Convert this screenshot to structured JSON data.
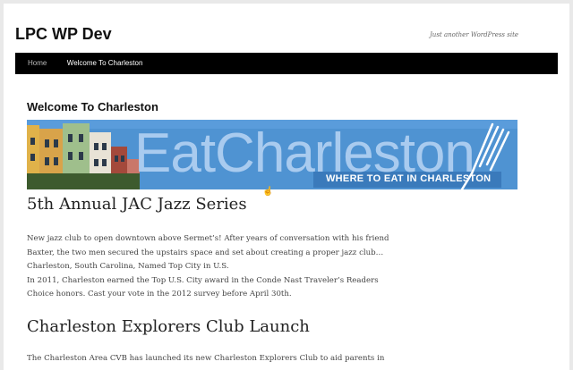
{
  "site": {
    "title": "LPC WP Dev",
    "tagline": "Just another WordPress site"
  },
  "nav": {
    "items": [
      {
        "label": "Home"
      },
      {
        "label": "Welcome To Charleston"
      }
    ]
  },
  "page": {
    "heading": "Welcome To Charleston"
  },
  "banner": {
    "wordmark": "EatCharleston",
    "tagline": "WHERE TO EAT IN CHARLESTON",
    "colors": {
      "sky": "#4f93d2",
      "wordmark": "#a9cbef",
      "tag": "#ffffff"
    }
  },
  "posts": [
    {
      "title": "5th Annual JAC Jazz Series",
      "lines": [
        "New jazz club to open downtown above Sermet’s! After years of conversation with his friend",
        "Baxter, the two men secured the upstairs space and set about creating a proper jazz club…",
        "Charleston, South Carolina, Named Top City in U.S.",
        "In 2011, Charleston earned the Top U.S. City award in the Conde Nast Traveler’s Readers",
        "Choice honors. Cast your vote in the 2012 survey before April 30th."
      ]
    },
    {
      "title": "Charleston Explorers Club Launch",
      "lines": [
        "The Charleston Area CVB has launched its new Charleston Explorers Club to aid parents in"
      ]
    }
  ]
}
